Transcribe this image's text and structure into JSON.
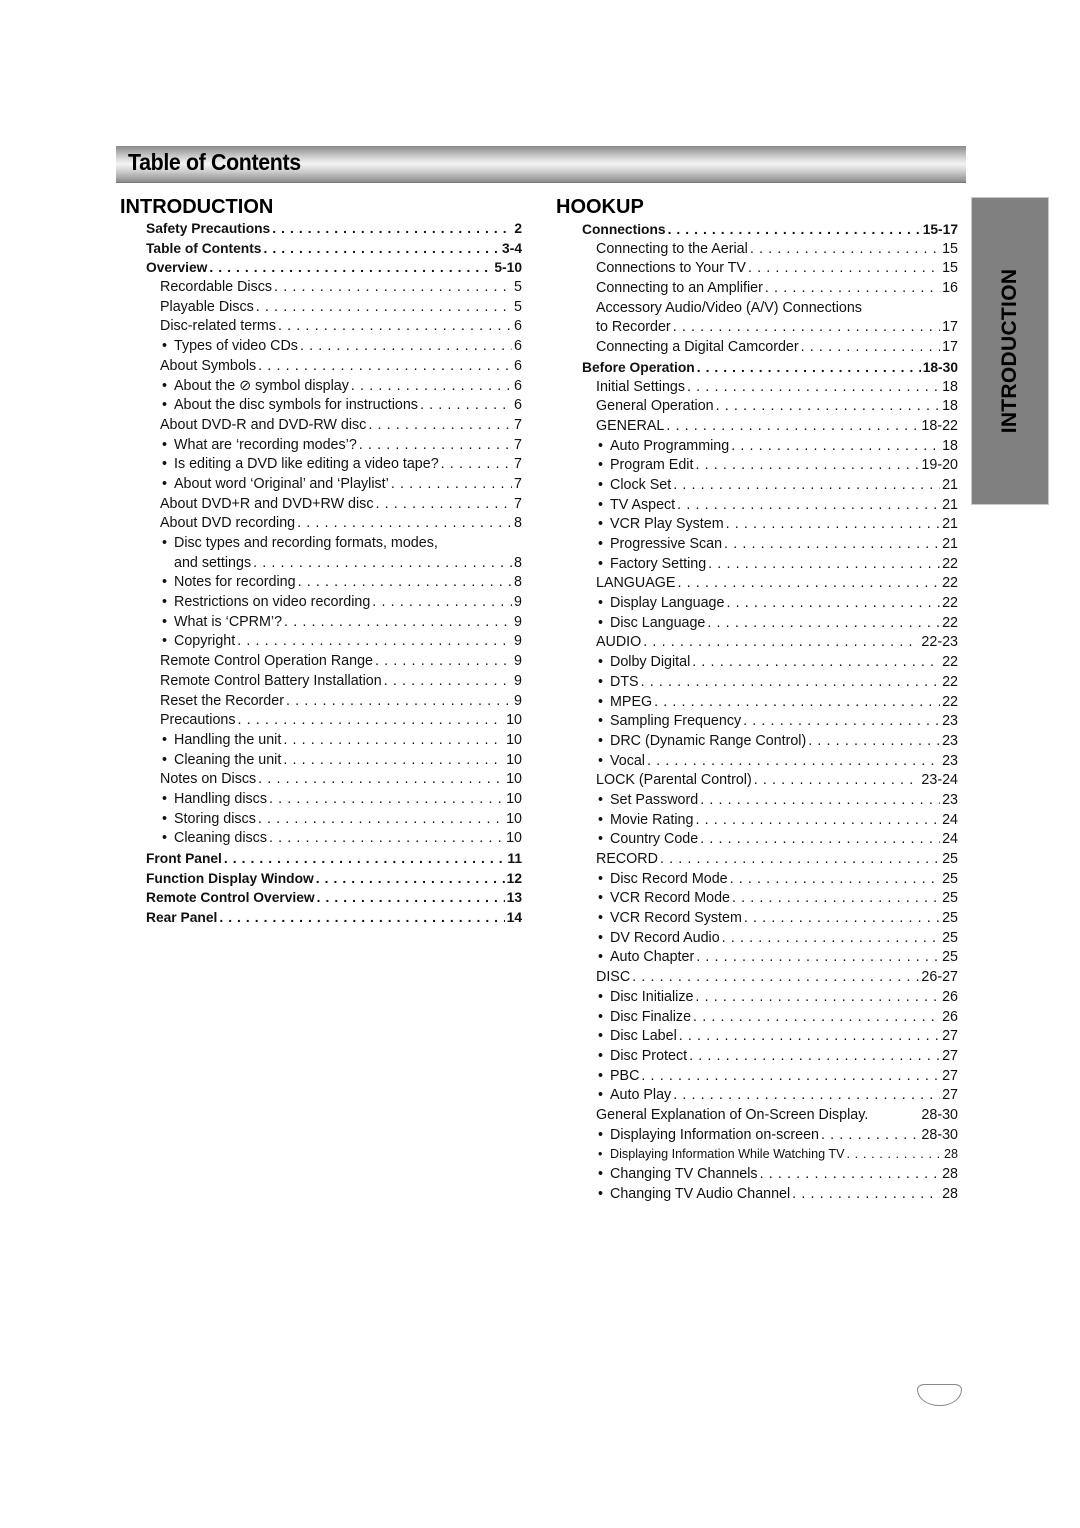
{
  "header": {
    "title": "Table of Contents"
  },
  "side_tab": {
    "label": "INTRODUCTION"
  },
  "sections": {
    "introduction": {
      "heading": "INTRODUCTION",
      "entries": [
        {
          "text": "Safety Precautions",
          "page": "2",
          "level": 0,
          "bold": true
        },
        {
          "text": "Table of Contents",
          "page": "3-4",
          "level": 0,
          "bold": true
        },
        {
          "text": "Overview",
          "page": "5-10",
          "level": 0,
          "bold": true
        },
        {
          "text": "Recordable Discs",
          "page": "5",
          "level": 1
        },
        {
          "text": "Playable Discs",
          "page": "5",
          "level": 1
        },
        {
          "text": "Disc-related terms",
          "page": "6",
          "level": 1
        },
        {
          "text": "Types of video CDs",
          "page": "6",
          "level": 2
        },
        {
          "text": "About Symbols",
          "page": "6",
          "level": 1
        },
        {
          "text": "About the ⊘ symbol display",
          "page": "6",
          "level": 2
        },
        {
          "text": "About the disc symbols for instructions",
          "page": "6",
          "level": 2
        },
        {
          "text": "About DVD-R and DVD-RW disc",
          "page": "7",
          "level": 1
        },
        {
          "text": "What are ‘recording modes’?",
          "page": "7",
          "level": 2
        },
        {
          "text": "Is editing a DVD like editing a video tape?",
          "page": "7",
          "level": 2
        },
        {
          "text": "About word ‘Original’ and ‘Playlist’",
          "page": "7",
          "level": 2
        },
        {
          "text": "About DVD+R and DVD+RW disc",
          "page": "7",
          "level": 1
        },
        {
          "text": "About DVD recording",
          "page": "8",
          "level": 1
        },
        {
          "text": "Disc types and recording formats, modes,",
          "page": "",
          "level": 2
        },
        {
          "text": "and settings",
          "page": "8",
          "level": 2,
          "continuation": true
        },
        {
          "text": "Notes for recording",
          "page": "8",
          "level": 2
        },
        {
          "text": "Restrictions on video recording",
          "page": "9",
          "level": 2
        },
        {
          "text": "What is ‘CPRM’?",
          "page": "9",
          "level": 2
        },
        {
          "text": "Copyright",
          "page": "9",
          "level": 2
        },
        {
          "text": "Remote Control Operation Range",
          "page": "9",
          "level": 1
        },
        {
          "text": "Remote Control Battery Installation",
          "page": "9",
          "level": 1
        },
        {
          "text": "Reset the Recorder",
          "page": "9",
          "level": 1
        },
        {
          "text": "Precautions",
          "page": "10",
          "level": 1
        },
        {
          "text": "Handling the unit",
          "page": "10",
          "level": 2
        },
        {
          "text": "Cleaning the unit",
          "page": "10",
          "level": 2
        },
        {
          "text": "Notes on Discs",
          "page": "10",
          "level": 1
        },
        {
          "text": "Handling discs",
          "page": "10",
          "level": 2
        },
        {
          "text": "Storing discs",
          "page": "10",
          "level": 2
        },
        {
          "text": "Cleaning discs",
          "page": "10",
          "level": 2
        },
        {
          "text": "Front Panel",
          "page": "11",
          "level": 0,
          "bold": true
        },
        {
          "text": "Function Display Window",
          "page": "12",
          "level": 0,
          "bold": true
        },
        {
          "text": "Remote Control Overview",
          "page": "13",
          "level": 0,
          "bold": true
        },
        {
          "text": "Rear Panel",
          "page": "14",
          "level": 0,
          "bold": true
        }
      ]
    },
    "hookup": {
      "heading": "HOOKUP",
      "entries": [
        {
          "text": "Connections",
          "page": "15-17",
          "level": 0,
          "bold": true
        },
        {
          "text": "Connecting to the Aerial",
          "page": "15",
          "level": 1
        },
        {
          "text": "Connections to Your TV",
          "page": "15",
          "level": 1
        },
        {
          "text": "Connecting to an Amplifier",
          "page": "16",
          "level": 1
        },
        {
          "text": "Accessory Audio/Video (A/V) Connections",
          "page": "",
          "level": 1
        },
        {
          "text": "to Recorder",
          "page": "17",
          "level": 1
        },
        {
          "text": "Connecting a Digital Camcorder",
          "page": "17",
          "level": 1
        },
        {
          "text": "Before Operation",
          "page": "18-30",
          "level": 0,
          "bold": true
        },
        {
          "text": "Initial Settings",
          "page": "18",
          "level": 1
        },
        {
          "text": "General Operation",
          "page": "18",
          "level": 1
        },
        {
          "text": "GENERAL",
          "page": "18-22",
          "level": 1
        },
        {
          "text": "Auto Programming",
          "page": "18",
          "level": 2
        },
        {
          "text": "Program Edit",
          "page": "19-20",
          "level": 2
        },
        {
          "text": "Clock Set",
          "page": "21",
          "level": 2
        },
        {
          "text": "TV Aspect",
          "page": "21",
          "level": 2
        },
        {
          "text": "VCR Play System",
          "page": "21",
          "level": 2
        },
        {
          "text": "Progressive Scan",
          "page": "21",
          "level": 2
        },
        {
          "text": "Factory Setting",
          "page": "22",
          "level": 2
        },
        {
          "text": "LANGUAGE",
          "page": "22",
          "level": 1
        },
        {
          "text": "Display Language",
          "page": "22",
          "level": 2
        },
        {
          "text": "Disc Language",
          "page": "22",
          "level": 2
        },
        {
          "text": "AUDIO",
          "page": "22-23",
          "level": 1
        },
        {
          "text": "Dolby Digital",
          "page": "22",
          "level": 2
        },
        {
          "text": "DTS",
          "page": "22",
          "level": 2
        },
        {
          "text": "MPEG",
          "page": "22",
          "level": 2
        },
        {
          "text": "Sampling Frequency",
          "page": "23",
          "level": 2
        },
        {
          "text": "DRC (Dynamic Range Control)",
          "page": "23",
          "level": 2
        },
        {
          "text": "Vocal",
          "page": "23",
          "level": 2
        },
        {
          "text": "LOCK (Parental Control)",
          "page": "23-24",
          "level": 1
        },
        {
          "text": "Set Password",
          "page": "23",
          "level": 2
        },
        {
          "text": "Movie Rating",
          "page": "24",
          "level": 2
        },
        {
          "text": "Country Code",
          "page": "24",
          "level": 2
        },
        {
          "text": "RECORD",
          "page": "25",
          "level": 1
        },
        {
          "text": "Disc Record Mode",
          "page": "25",
          "level": 2
        },
        {
          "text": "VCR Record Mode",
          "page": "25",
          "level": 2
        },
        {
          "text": "VCR Record System",
          "page": "25",
          "level": 2
        },
        {
          "text": "DV Record Audio",
          "page": "25",
          "level": 2
        },
        {
          "text": "Auto Chapter",
          "page": "25",
          "level": 2
        },
        {
          "text": "DISC",
          "page": "26-27",
          "level": 1
        },
        {
          "text": "Disc Initialize",
          "page": "26",
          "level": 2
        },
        {
          "text": "Disc Finalize",
          "page": "26",
          "level": 2
        },
        {
          "text": "Disc Label",
          "page": "27",
          "level": 2
        },
        {
          "text": "Disc Protect",
          "page": "27",
          "level": 2
        },
        {
          "text": "PBC",
          "page": "27",
          "level": 2
        },
        {
          "text": "Auto Play",
          "page": "27",
          "level": 2
        },
        {
          "text": "General Explanation of On-Screen Display.",
          "page": "28-30",
          "level": 1,
          "nodots": true
        },
        {
          "text": "Displaying Information on-screen",
          "page": "28-30",
          "level": 2
        },
        {
          "text": "Displaying Information While Watching TV",
          "page": "28",
          "level": 2,
          "small": true
        },
        {
          "text": "Changing TV Channels",
          "page": "28",
          "level": 2
        },
        {
          "text": "Changing TV Audio Channel",
          "page": "28",
          "level": 2
        }
      ]
    }
  },
  "bullet_glyph": "•"
}
